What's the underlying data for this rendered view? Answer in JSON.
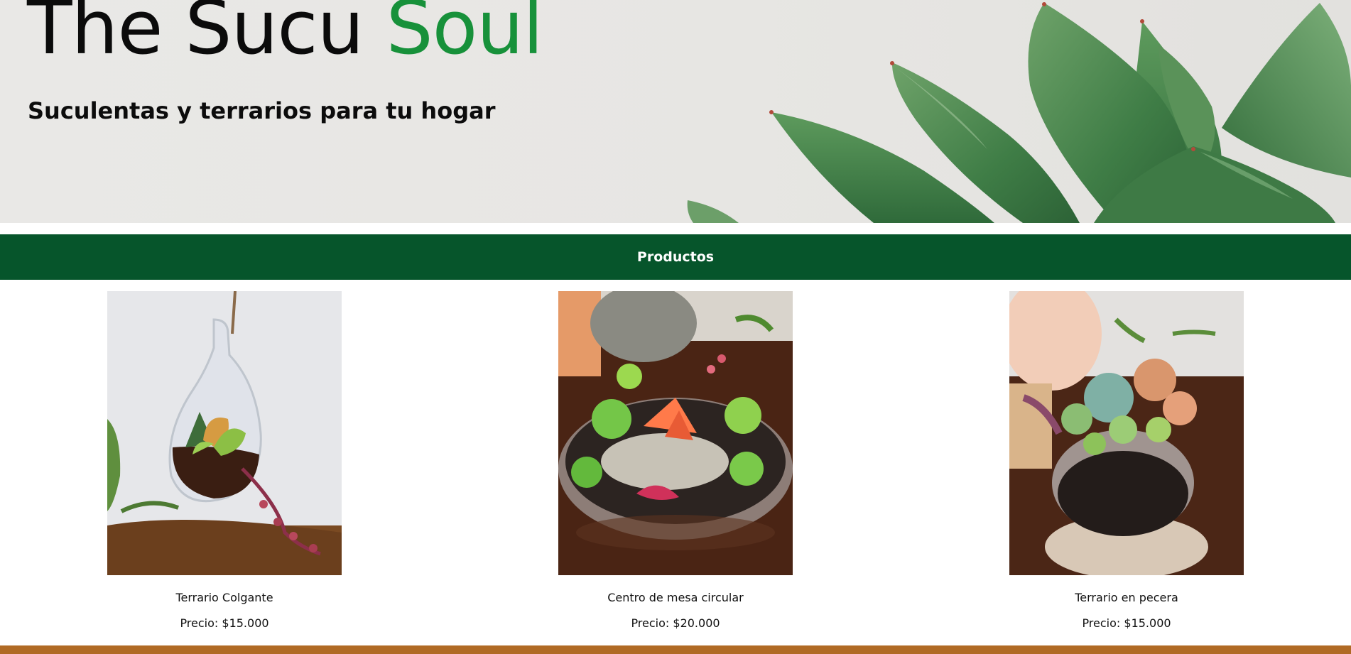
{
  "hero": {
    "title_main": "The Sucu ",
    "title_accent": "Soul",
    "tagline": "Suculentas y terrarios para tu hogar"
  },
  "nav": {
    "label": "Productos"
  },
  "products": [
    {
      "name": "Terrario Colgante",
      "price": "Precio: $15.000"
    },
    {
      "name": "Centro de mesa circular",
      "price": "Precio: $20.000"
    },
    {
      "name": "Terrario en pecera",
      "price": "Precio: $15.000"
    }
  ],
  "colors": {
    "brand_green": "#17913a",
    "nav_green": "#06552b",
    "footer_brown": "#b06a24"
  }
}
